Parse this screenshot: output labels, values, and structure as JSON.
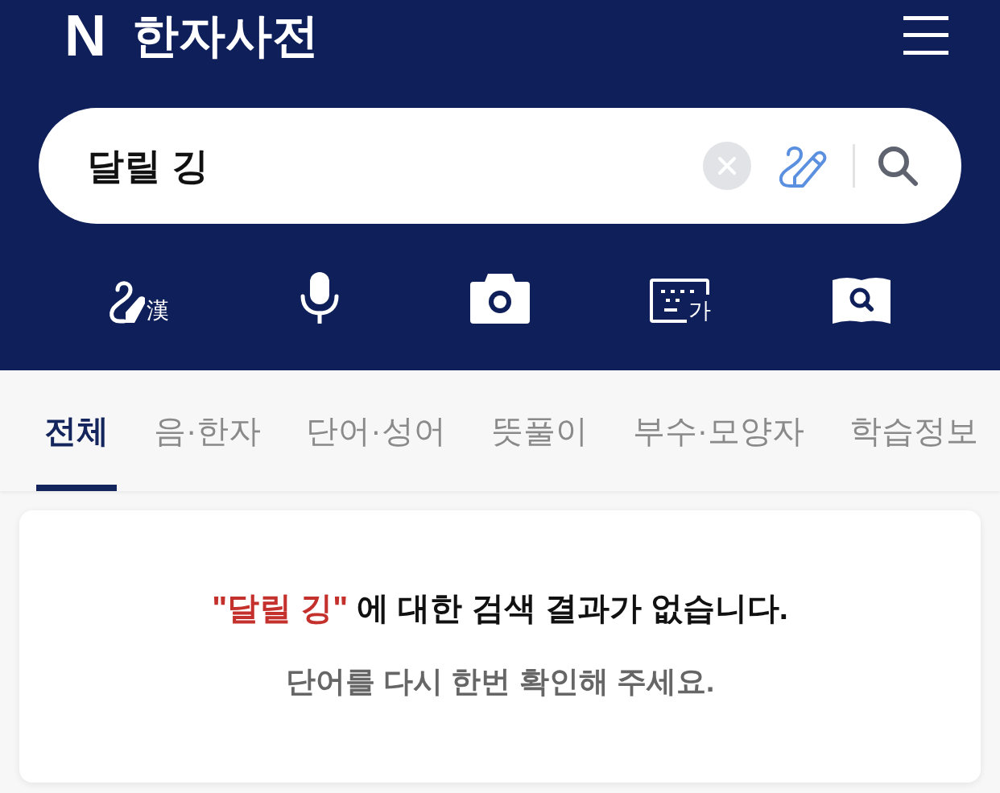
{
  "header": {
    "logo": "N",
    "title": "한자사전"
  },
  "search": {
    "value": "달릴 깅"
  },
  "tools": [
    {
      "kind": "handwriting",
      "label": "漢"
    },
    {
      "kind": "voice"
    },
    {
      "kind": "camera"
    },
    {
      "kind": "keyboard",
      "label": "가"
    },
    {
      "kind": "book-search"
    }
  ],
  "tabs": [
    {
      "label": "전체",
      "selected": true
    },
    {
      "label": "음·한자",
      "selected": false
    },
    {
      "label": "단어·성어",
      "selected": false
    },
    {
      "label": "뜻풀이",
      "selected": false
    },
    {
      "label": "부수·모양자",
      "selected": false
    },
    {
      "label": "학습정보",
      "selected": false
    }
  ],
  "no_result": {
    "query": "\"달릴 깅\"",
    "text": "에 대한 검색 결과가 없습니다.",
    "hint": "단어를 다시 한번 확인해 주세요."
  }
}
